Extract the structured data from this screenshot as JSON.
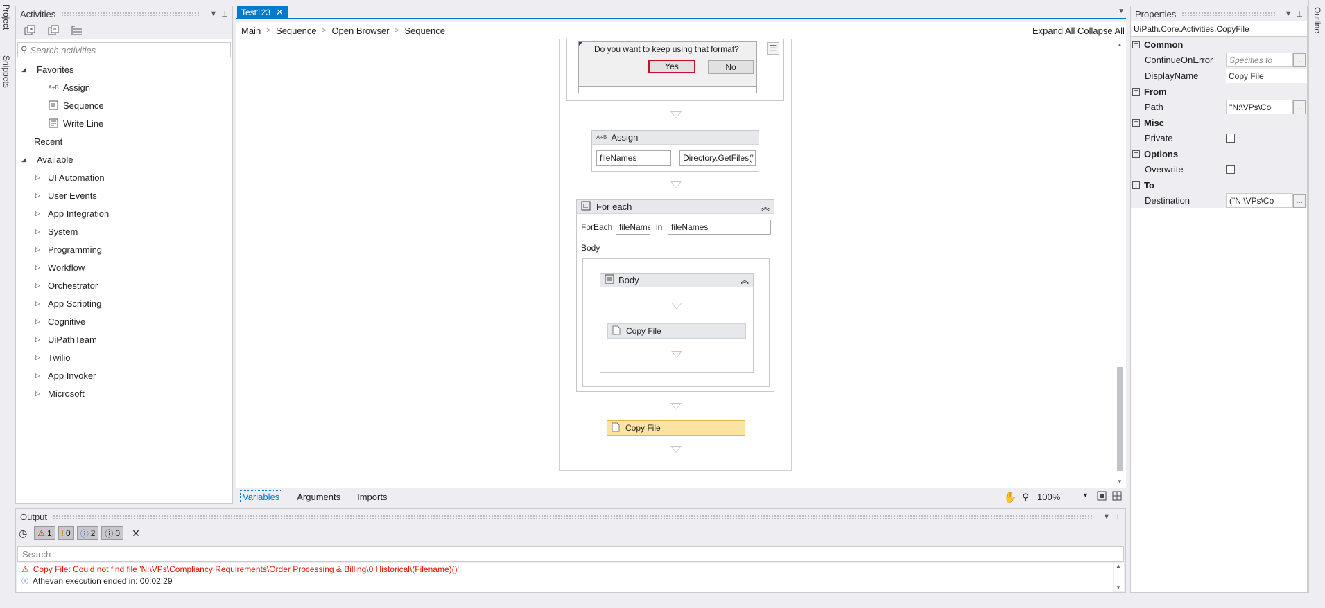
{
  "left_strip": {
    "tabs": [
      "Project",
      "Snippets"
    ]
  },
  "right_strip": {
    "tabs": [
      "Outline"
    ]
  },
  "activities": {
    "title": "Activities",
    "search_placeholder": "Search activities",
    "favorites_label": "Favorites",
    "favorites": [
      {
        "label": "Assign",
        "icon": "assign-icon"
      },
      {
        "label": "Sequence",
        "icon": "sequence-icon"
      },
      {
        "label": "Write Line",
        "icon": "write-line-icon"
      }
    ],
    "recent_label": "Recent",
    "available_label": "Available",
    "available": [
      "UI Automation",
      "User Events",
      "App Integration",
      "System",
      "Programming",
      "Workflow",
      "Orchestrator",
      "App Scripting",
      "Cognitive",
      "UiPathTeam",
      "Twilio",
      "App Invoker",
      "Microsoft"
    ]
  },
  "document": {
    "tab_label": "Test123",
    "breadcrumb": [
      "Main",
      "Sequence",
      "Open Browser",
      "Sequence"
    ],
    "expand_all": "Expand All",
    "collapse_all": "Collapse All"
  },
  "workflow": {
    "dialog_prompt": "Do you want to keep using that format?",
    "dialog_yes": "Yes",
    "dialog_no": "No",
    "assign": {
      "title": "Assign",
      "target": "fileNames",
      "equals": "=",
      "value": "Directory.GetFiles(\""
    },
    "foreach": {
      "title": "For each",
      "foreach_label": "ForEach",
      "item": "fileName",
      "in_label": "in",
      "collection": "fileNames",
      "body_label": "Body"
    },
    "body": {
      "title": "Body",
      "inner_activity": "Copy File"
    },
    "selected_activity": "Copy File"
  },
  "designer_bar": {
    "tabs": [
      "Variables",
      "Arguments",
      "Imports"
    ],
    "zoom": "100%"
  },
  "properties": {
    "title": "Properties",
    "type_name": "UiPath.Core.Activities.CopyFile",
    "categories": {
      "common": "Common",
      "from": "From",
      "misc": "Misc",
      "options": "Options",
      "to": "To"
    },
    "continue_on_error_name": "ContinueOnError",
    "continue_on_error_placeholder": "Specifies to",
    "display_name_name": "DisplayName",
    "display_name_value": "Copy File",
    "path_name": "Path",
    "path_value": "\"N:\\VPs\\Co",
    "private_name": "Private",
    "overwrite_name": "Overwrite",
    "destination_name": "Destination",
    "destination_value": "(\"N:\\VPs\\Co",
    "ellipsis": "..."
  },
  "output": {
    "title": "Output",
    "error_count": "1",
    "warning_count": "0",
    "info_count": "2",
    "trace_count": "0",
    "search_placeholder": "Search",
    "lines": [
      {
        "type": "error",
        "text": "Copy File: Could not find file 'N:\\VPs\\Compliancy Requirements\\Order Processing & Billing\\0 Historical\\(Filename)()'."
      },
      {
        "type": "info",
        "text": "Athevan execution ended in: 00:02:29"
      }
    ]
  },
  "colors": {
    "accent": "#007acc",
    "error": "#e51400",
    "selected_activity": "#fbe4a3",
    "dialog_highlight": "#c8102e"
  }
}
